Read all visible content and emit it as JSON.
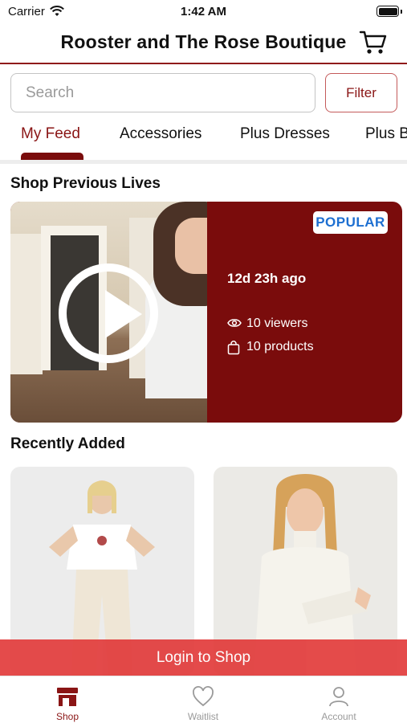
{
  "status_bar": {
    "carrier": "Carrier",
    "time": "1:42 AM"
  },
  "header": {
    "title": "Rooster and The Rose Boutique",
    "cart_icon": "cart-icon"
  },
  "search": {
    "placeholder": "Search",
    "value": ""
  },
  "filter": {
    "label": "Filter"
  },
  "tabs": [
    {
      "label": "My Feed",
      "active": true
    },
    {
      "label": "Accessories",
      "active": false
    },
    {
      "label": "Plus Dresses",
      "active": false
    },
    {
      "label": "Plus B",
      "active": false
    }
  ],
  "sections": {
    "previous_lives": "Shop Previous Lives",
    "recently_added": "Recently Added"
  },
  "live": {
    "badge": "POPULAR",
    "ago": "12d 23h ago",
    "viewers": "10 viewers",
    "products": "10 products",
    "play_icon": "play-icon"
  },
  "login_banner": "Login to Shop",
  "nav": [
    {
      "label": "Shop",
      "icon": "shop-icon",
      "active": true
    },
    {
      "label": "Waitlist",
      "icon": "heart-icon",
      "active": false
    },
    {
      "label": "Account",
      "icon": "user-icon",
      "active": false
    }
  ],
  "colors": {
    "brand": "#7a0c0c",
    "accent_text": "#8a1515",
    "banner": "#e23d3d",
    "badge_text": "#1d6fd1"
  }
}
